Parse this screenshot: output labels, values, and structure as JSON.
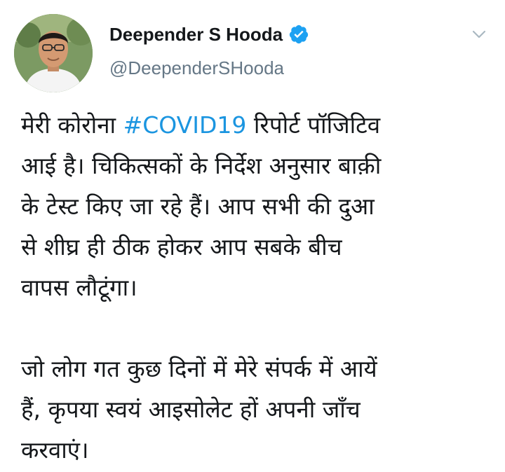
{
  "author": {
    "display_name": "Deepender S Hooda",
    "handle": "@DeependerSHooda"
  },
  "tweet": {
    "p1_before": "मेरी कोरोना ",
    "hashtag": "#COVID19",
    "p1_after": " रिपोर्ट पॉजिटिव",
    "line2": "आई है। चिकित्सकों के निर्देश अनुसार बाक़ी",
    "line3": "के टेस्ट किए जा रहे हैं। आप सभी की दुआ",
    "line4": "से शीघ्र ही ठीक होकर आप सबके बीच",
    "line5": "वापस लौटूंगा।",
    "line6": "जो लोग गत कुछ दिनों में मेरे संपर्क में आयें",
    "line7": "हैं, कृपया स्वयं आइसोलेट हों अपनी जाँच",
    "line8": "करवाएं।"
  },
  "icons": {
    "verified": "verified-badge-icon",
    "menu": "chevron-down-icon"
  },
  "colors": {
    "link": "#1b95e0",
    "verified": "#1da1f2",
    "text": "#14171a",
    "secondary": "#657786"
  }
}
